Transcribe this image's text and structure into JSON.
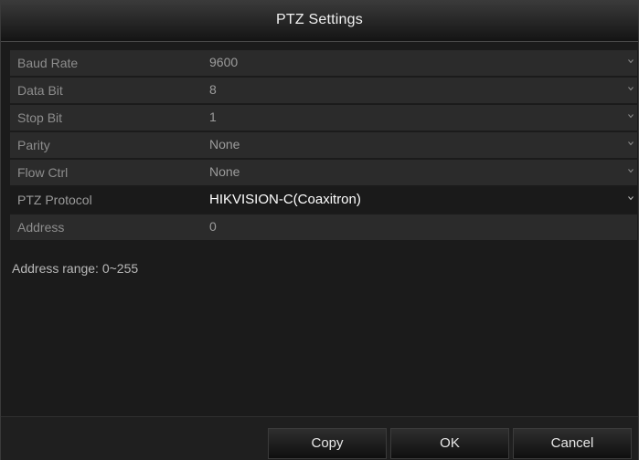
{
  "window": {
    "title": "PTZ Settings"
  },
  "settings": [
    {
      "label": "Baud Rate",
      "value": "9600"
    },
    {
      "label": "Data Bit",
      "value": "8"
    },
    {
      "label": "Stop Bit",
      "value": "1"
    },
    {
      "label": "Parity",
      "value": "None"
    },
    {
      "label": "Flow Ctrl",
      "value": "None"
    },
    {
      "label": "PTZ Protocol",
      "value": "HIKVISION-C(Coaxitron)"
    },
    {
      "label": "Address",
      "value": "0"
    }
  ],
  "hint": "Address range: 0~255",
  "buttons": {
    "copy": "Copy",
    "ok": "OK",
    "cancel": "Cancel"
  },
  "icons": {
    "dropdown": "chevron-down-icon"
  },
  "colors": {
    "background": "#1b1b1b",
    "row": "#2b2b2b",
    "row_highlight": "#1a1a1a",
    "text_muted": "#8d8d8d",
    "text_bright": "#ffffff"
  }
}
